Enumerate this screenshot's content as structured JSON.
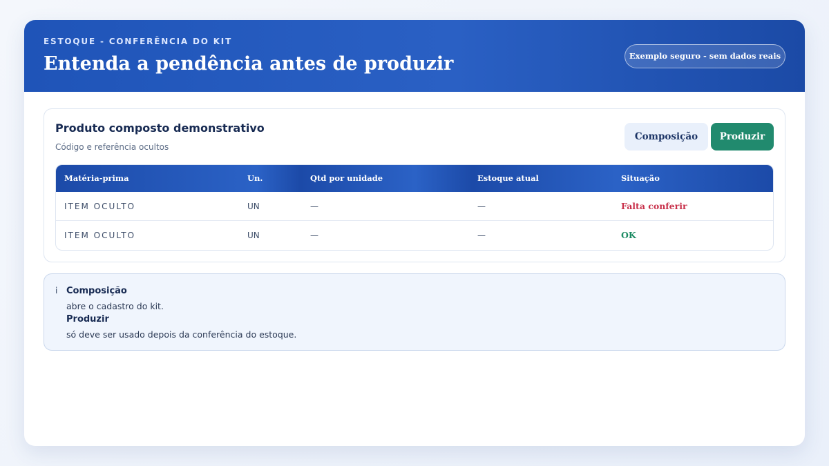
{
  "header": {
    "eyebrow": "ESTOQUE - CONFERÊNCIA DO KIT",
    "title": "Entenda a pendência antes de produzir",
    "badge": "Exemplo seguro - sem dados reais"
  },
  "product": {
    "name": "Produto composto demonstrativo",
    "subtitle": "Código e referência ocultos",
    "buttons": {
      "composition": "Composição",
      "produce": "Produzir"
    }
  },
  "table": {
    "columns": [
      "Matéria-prima",
      "Un.",
      "Qtd por unidade",
      "Estoque atual",
      "Situação"
    ],
    "rows": [
      {
        "material": "ITEM OCULTO",
        "unit": "UN",
        "qty": "—",
        "stock": "—",
        "status": "Falta conferir"
      },
      {
        "material": "ITEM OCULTO",
        "unit": "UN",
        "qty": "—",
        "stock": "—",
        "status": "OK"
      }
    ]
  },
  "info": {
    "icon": "i",
    "items": [
      {
        "term": "Composição",
        "desc": "abre o cadastro do kit."
      },
      {
        "term": "Produzir",
        "desc": "só deve ser usado depois da conferência do estoque."
      }
    ]
  },
  "colors": {
    "header_blue": "#2a60c4",
    "produce_green": "#218a6e",
    "pending_red": "#c8304a",
    "ok_green": "#1b8a62"
  }
}
